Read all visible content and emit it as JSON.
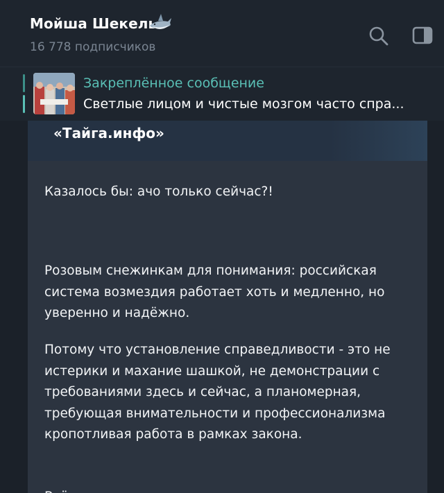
{
  "header": {
    "channel_title": "Мойша Шекель",
    "title_emoji": "shark-icon",
    "subscribers": "16 778 подписчиков",
    "actions": [
      "search-icon",
      "side-panel-icon"
    ]
  },
  "pinned": {
    "label": "Закреплённое сообщение",
    "text": "Светлые лицом и чистые мозгом часто спра..."
  },
  "message": {
    "preview_title": "«Тайга.инфо»",
    "paragraphs": [
      "Казалось бы: ачо только сейчас?!",
      "Розовым снежинкам для понимания: российская система возмездия работает хоть и медленно, но уверенно и надёжно.",
      "Потому что установление справедливости - это не истерики и махание шашкой, не демонстрации с требованиями здесь и сейчас, а планомерная, требующая внимательности и профессионализма кропотливая работа в рамках закона.",
      "Всё остальное - хохлизм, махновщина и самосуд."
    ]
  },
  "colors": {
    "background": "#1b2129",
    "header_bg": "#1e252e",
    "bubble_bg": "#2c3440",
    "accent": "#5ac0b6",
    "secondary_text": "#7a8592"
  }
}
